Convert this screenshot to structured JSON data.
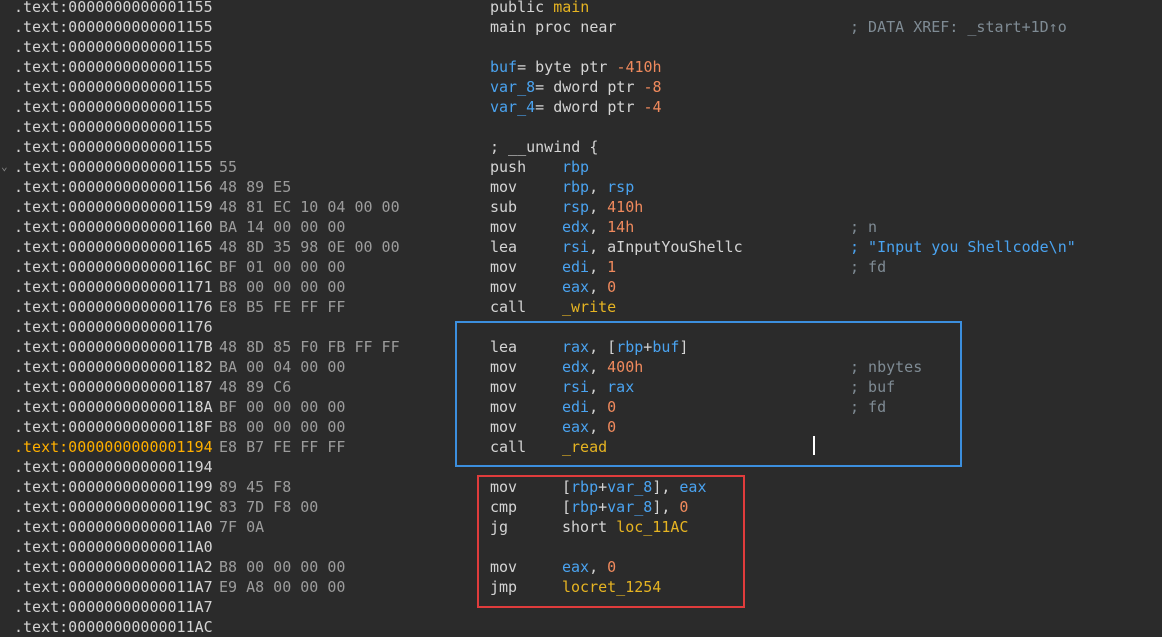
{
  "title": "",
  "lines": [
    {
      "addr": ".text:0000000000001155",
      "bytes": "",
      "mnem": "public",
      "ops": [
        {
          "t": "main",
          "c": "name"
        }
      ],
      "cmt": ""
    },
    {
      "addr": ".text:0000000000001155",
      "bytes": "",
      "mnem": "main proc near",
      "ops": [],
      "cmt": "; DATA XREF: _start+1D↑o"
    },
    {
      "addr": ".text:0000000000001155",
      "bytes": "",
      "mnem": "",
      "ops": [],
      "cmt": ""
    },
    {
      "addr": ".text:0000000000001155",
      "bytes": "",
      "mnem": "",
      "ops": [],
      "cmt": "",
      "decl": [
        {
          "t": "buf",
          "c": "var"
        },
        {
          "t": "= byte ptr ",
          "c": "plain"
        },
        {
          "t": "-410h",
          "c": "num"
        }
      ]
    },
    {
      "addr": ".text:0000000000001155",
      "bytes": "",
      "mnem": "",
      "ops": [],
      "cmt": "",
      "decl": [
        {
          "t": "var_8",
          "c": "var"
        },
        {
          "t": "= dword ptr ",
          "c": "plain"
        },
        {
          "t": "-8",
          "c": "num"
        }
      ]
    },
    {
      "addr": ".text:0000000000001155",
      "bytes": "",
      "mnem": "",
      "ops": [],
      "cmt": "",
      "decl": [
        {
          "t": "var_4",
          "c": "var"
        },
        {
          "t": "= dword ptr ",
          "c": "plain"
        },
        {
          "t": "-4",
          "c": "num"
        }
      ]
    },
    {
      "addr": ".text:0000000000001155",
      "bytes": "",
      "mnem": "",
      "ops": [],
      "cmt": ""
    },
    {
      "addr": ".text:0000000000001155",
      "bytes": "",
      "mnem": "; __unwind {",
      "ops": [],
      "cmt": ""
    },
    {
      "addr": ".text:0000000000001155",
      "bytes": "55",
      "mnem": "push",
      "ops": [
        {
          "t": "rbp",
          "c": "reg"
        }
      ],
      "cmt": "",
      "arrow": true
    },
    {
      "addr": ".text:0000000000001156",
      "bytes": "48 89 E5",
      "mnem": "mov",
      "ops": [
        {
          "t": "rbp",
          "c": "reg"
        },
        {
          "t": ", ",
          "c": "plain"
        },
        {
          "t": "rsp",
          "c": "reg"
        }
      ],
      "cmt": ""
    },
    {
      "addr": ".text:0000000000001159",
      "bytes": "48 81 EC 10 04 00 00",
      "mnem": "sub",
      "ops": [
        {
          "t": "rsp",
          "c": "reg"
        },
        {
          "t": ", ",
          "c": "plain"
        },
        {
          "t": "410h",
          "c": "num"
        }
      ],
      "cmt": ""
    },
    {
      "addr": ".text:0000000000001160",
      "bytes": "BA 14 00 00 00",
      "mnem": "mov",
      "ops": [
        {
          "t": "edx",
          "c": "reg"
        },
        {
          "t": ", ",
          "c": "plain"
        },
        {
          "t": "14h",
          "c": "num"
        }
      ],
      "cmt": "; n"
    },
    {
      "addr": ".text:0000000000001165",
      "bytes": "48 8D 35 98 0E 00 00",
      "mnem": "lea",
      "ops": [
        {
          "t": "rsi",
          "c": "reg"
        },
        {
          "t": ", aInputYouShellc",
          "c": "plain"
        }
      ],
      "cmt": "; \"Input you Shellcode\\n\"",
      "cmtStr": true
    },
    {
      "addr": ".text:000000000000116C",
      "bytes": "BF 01 00 00 00",
      "mnem": "mov",
      "ops": [
        {
          "t": "edi",
          "c": "reg"
        },
        {
          "t": ", ",
          "c": "plain"
        },
        {
          "t": "1",
          "c": "num"
        }
      ],
      "cmt": "; fd"
    },
    {
      "addr": ".text:0000000000001171",
      "bytes": "B8 00 00 00 00",
      "mnem": "mov",
      "ops": [
        {
          "t": "eax",
          "c": "reg"
        },
        {
          "t": ", ",
          "c": "plain"
        },
        {
          "t": "0",
          "c": "num"
        }
      ],
      "cmt": ""
    },
    {
      "addr": ".text:0000000000001176",
      "bytes": "E8 B5 FE FF FF",
      "mnem": "call",
      "ops": [
        {
          "t": "_write",
          "c": "name"
        }
      ],
      "cmt": ""
    },
    {
      "addr": ".text:0000000000001176",
      "bytes": "",
      "mnem": "",
      "ops": [],
      "cmt": ""
    },
    {
      "addr": ".text:000000000000117B",
      "bytes": "48 8D 85 F0 FB FF FF",
      "mnem": "lea",
      "ops": [
        {
          "t": "rax",
          "c": "reg"
        },
        {
          "t": ", [",
          "c": "plain"
        },
        {
          "t": "rbp",
          "c": "reg"
        },
        {
          "t": "+",
          "c": "plain"
        },
        {
          "t": "buf",
          "c": "var"
        },
        {
          "t": "]",
          "c": "plain"
        }
      ],
      "cmt": ""
    },
    {
      "addr": ".text:0000000000001182",
      "bytes": "BA 00 04 00 00",
      "mnem": "mov",
      "ops": [
        {
          "t": "edx",
          "c": "reg"
        },
        {
          "t": ", ",
          "c": "plain"
        },
        {
          "t": "400h",
          "c": "num"
        }
      ],
      "cmt": "; nbytes"
    },
    {
      "addr": ".text:0000000000001187",
      "bytes": "48 89 C6",
      "mnem": "mov",
      "ops": [
        {
          "t": "rsi",
          "c": "reg"
        },
        {
          "t": ", ",
          "c": "plain"
        },
        {
          "t": "rax",
          "c": "reg"
        }
      ],
      "cmt": "; buf"
    },
    {
      "addr": ".text:000000000000118A",
      "bytes": "BF 00 00 00 00",
      "mnem": "mov",
      "ops": [
        {
          "t": "edi",
          "c": "reg"
        },
        {
          "t": ", ",
          "c": "plain"
        },
        {
          "t": "0",
          "c": "num"
        }
      ],
      "cmt": "; fd"
    },
    {
      "addr": ".text:000000000000118F",
      "bytes": "B8 00 00 00 00",
      "mnem": "mov",
      "ops": [
        {
          "t": "eax",
          "c": "reg"
        },
        {
          "t": ", ",
          "c": "plain"
        },
        {
          "t": "0",
          "c": "num"
        }
      ],
      "cmt": ""
    },
    {
      "addr": ".text:0000000000001194",
      "bytes": "E8 B7 FE FF FF",
      "mnem": "call",
      "ops": [
        {
          "t": "_read",
          "c": "name"
        }
      ],
      "cmt": "",
      "selected": true
    },
    {
      "addr": ".text:0000000000001194",
      "bytes": "",
      "mnem": "",
      "ops": [],
      "cmt": ""
    },
    {
      "addr": ".text:0000000000001199",
      "bytes": "89 45 F8",
      "mnem": "mov",
      "ops": [
        {
          "t": "[",
          "c": "plain"
        },
        {
          "t": "rbp",
          "c": "reg"
        },
        {
          "t": "+",
          "c": "plain"
        },
        {
          "t": "var_8",
          "c": "var"
        },
        {
          "t": "], ",
          "c": "plain"
        },
        {
          "t": "eax",
          "c": "reg"
        }
      ],
      "cmt": ""
    },
    {
      "addr": ".text:000000000000119C",
      "bytes": "83 7D F8 00",
      "mnem": "cmp",
      "ops": [
        {
          "t": "[",
          "c": "plain"
        },
        {
          "t": "rbp",
          "c": "reg"
        },
        {
          "t": "+",
          "c": "plain"
        },
        {
          "t": "var_8",
          "c": "var"
        },
        {
          "t": "], ",
          "c": "plain"
        },
        {
          "t": "0",
          "c": "num"
        }
      ],
      "cmt": ""
    },
    {
      "addr": ".text:00000000000011A0",
      "bytes": "7F 0A",
      "mnem": "jg",
      "ops": [
        {
          "t": "short ",
          "c": "plain"
        },
        {
          "t": "loc_11AC",
          "c": "name"
        }
      ],
      "cmt": ""
    },
    {
      "addr": ".text:00000000000011A0",
      "bytes": "",
      "mnem": "",
      "ops": [],
      "cmt": ""
    },
    {
      "addr": ".text:00000000000011A2",
      "bytes": "B8 00 00 00 00",
      "mnem": "mov",
      "ops": [
        {
          "t": "eax",
          "c": "reg"
        },
        {
          "t": ", ",
          "c": "plain"
        },
        {
          "t": "0",
          "c": "num"
        }
      ],
      "cmt": ""
    },
    {
      "addr": ".text:00000000000011A7",
      "bytes": "E9 A8 00 00 00",
      "mnem": "jmp",
      "ops": [
        {
          "t": "locret_1254",
          "c": "name"
        }
      ],
      "cmt": ""
    },
    {
      "addr": ".text:00000000000011A7",
      "bytes": "",
      "mnem": "",
      "ops": [],
      "cmt": ""
    },
    {
      "addr": ".text:00000000000011AC",
      "bytes": "",
      "mnem": "",
      "ops": [],
      "cmt": ""
    }
  ],
  "colors": {
    "background": "#2b2b2b",
    "register": "#4aa3f0",
    "number": "#f08a5d",
    "name": "#e6b422",
    "selected_address": "#ffb000",
    "highlight_box_blue": "#3c8fde",
    "highlight_box_red": "#e03c3c"
  }
}
